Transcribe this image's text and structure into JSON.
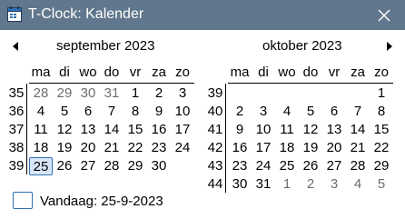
{
  "window": {
    "title": "T-Clock: Kalender",
    "titlebar_color": "#61778d",
    "icon": "calendar-icon"
  },
  "controls": {
    "close_icon": "close-icon",
    "prev_icon": "triangle-left-icon",
    "next_icon": "triangle-right-icon"
  },
  "weekday_headers": [
    "ma",
    "di",
    "wo",
    "do",
    "vr",
    "za",
    "zo"
  ],
  "months": [
    {
      "title": "september 2023",
      "weeks": [
        {
          "week": "35",
          "days": [
            {
              "d": "28",
              "m": true
            },
            {
              "d": "29",
              "m": true
            },
            {
              "d": "30",
              "m": true
            },
            {
              "d": "31",
              "m": true
            },
            {
              "d": "1"
            },
            {
              "d": "2"
            },
            {
              "d": "3"
            }
          ]
        },
        {
          "week": "36",
          "days": [
            {
              "d": "4"
            },
            {
              "d": "5"
            },
            {
              "d": "6"
            },
            {
              "d": "7"
            },
            {
              "d": "8"
            },
            {
              "d": "9"
            },
            {
              "d": "10"
            }
          ]
        },
        {
          "week": "37",
          "days": [
            {
              "d": "11"
            },
            {
              "d": "12"
            },
            {
              "d": "13"
            },
            {
              "d": "14"
            },
            {
              "d": "15"
            },
            {
              "d": "16"
            },
            {
              "d": "17"
            }
          ]
        },
        {
          "week": "38",
          "days": [
            {
              "d": "18"
            },
            {
              "d": "19"
            },
            {
              "d": "20"
            },
            {
              "d": "21"
            },
            {
              "d": "22"
            },
            {
              "d": "23"
            },
            {
              "d": "24"
            }
          ]
        },
        {
          "week": "39",
          "days": [
            {
              "d": "25",
              "today": true
            },
            {
              "d": "26"
            },
            {
              "d": "27"
            },
            {
              "d": "28"
            },
            {
              "d": "29"
            },
            {
              "d": "30"
            },
            {
              "d": ""
            }
          ]
        }
      ]
    },
    {
      "title": "oktober 2023",
      "weeks": [
        {
          "week": "39",
          "days": [
            {
              "d": ""
            },
            {
              "d": ""
            },
            {
              "d": ""
            },
            {
              "d": ""
            },
            {
              "d": ""
            },
            {
              "d": ""
            },
            {
              "d": "1"
            }
          ]
        },
        {
          "week": "40",
          "days": [
            {
              "d": "2"
            },
            {
              "d": "3"
            },
            {
              "d": "4"
            },
            {
              "d": "5"
            },
            {
              "d": "6"
            },
            {
              "d": "7"
            },
            {
              "d": "8"
            }
          ]
        },
        {
          "week": "41",
          "days": [
            {
              "d": "9"
            },
            {
              "d": "10"
            },
            {
              "d": "11"
            },
            {
              "d": "12"
            },
            {
              "d": "13"
            },
            {
              "d": "14"
            },
            {
              "d": "15"
            }
          ]
        },
        {
          "week": "42",
          "days": [
            {
              "d": "16"
            },
            {
              "d": "17"
            },
            {
              "d": "18"
            },
            {
              "d": "19"
            },
            {
              "d": "20"
            },
            {
              "d": "21"
            },
            {
              "d": "22"
            }
          ]
        },
        {
          "week": "43",
          "days": [
            {
              "d": "23"
            },
            {
              "d": "24"
            },
            {
              "d": "25"
            },
            {
              "d": "26"
            },
            {
              "d": "27"
            },
            {
              "d": "28"
            },
            {
              "d": "29"
            }
          ]
        },
        {
          "week": "44",
          "days": [
            {
              "d": "30"
            },
            {
              "d": "31"
            },
            {
              "d": "1",
              "m": true
            },
            {
              "d": "2",
              "m": true
            },
            {
              "d": "3",
              "m": true
            },
            {
              "d": "4",
              "m": true
            },
            {
              "d": "5",
              "m": true
            }
          ]
        }
      ]
    }
  ],
  "today": {
    "label": "Vandaag: 25-9-2023",
    "highlight_color": "#2f6fb3"
  }
}
